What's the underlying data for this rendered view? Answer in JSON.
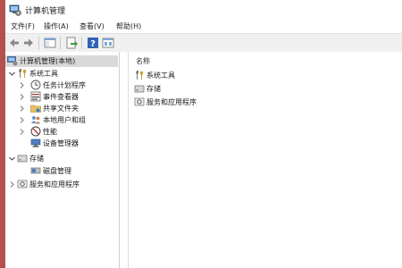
{
  "window": {
    "title": "计算机管理"
  },
  "menu": {
    "items": [
      "文件(F)",
      "操作(A)",
      "查看(V)",
      "帮助(H)"
    ]
  },
  "toolbar": {
    "buttons": [
      "back-icon",
      "forward-icon",
      "show-hide-tree-icon",
      "export-list-icon",
      "help-icon",
      "properties-icon"
    ]
  },
  "tree": {
    "root": "计算机管理(本地)",
    "system_tools": "系统工具",
    "task_scheduler": "任务计划程序",
    "event_viewer": "事件查看器",
    "shared_folders": "共享文件夹",
    "local_users": "本地用户和组",
    "performance": "性能",
    "device_manager": "设备管理器",
    "storage": "存储",
    "disk_management": "磁盘管理",
    "services_apps": "服务和应用程序"
  },
  "list": {
    "column_name": "名称",
    "items": [
      "系统工具",
      "存储",
      "服务和应用程序"
    ]
  },
  "colors": {
    "toolbar_bg": "#f0f0f0",
    "selection_bg": "#d9d9d9",
    "left_edge": "#b4514f"
  }
}
